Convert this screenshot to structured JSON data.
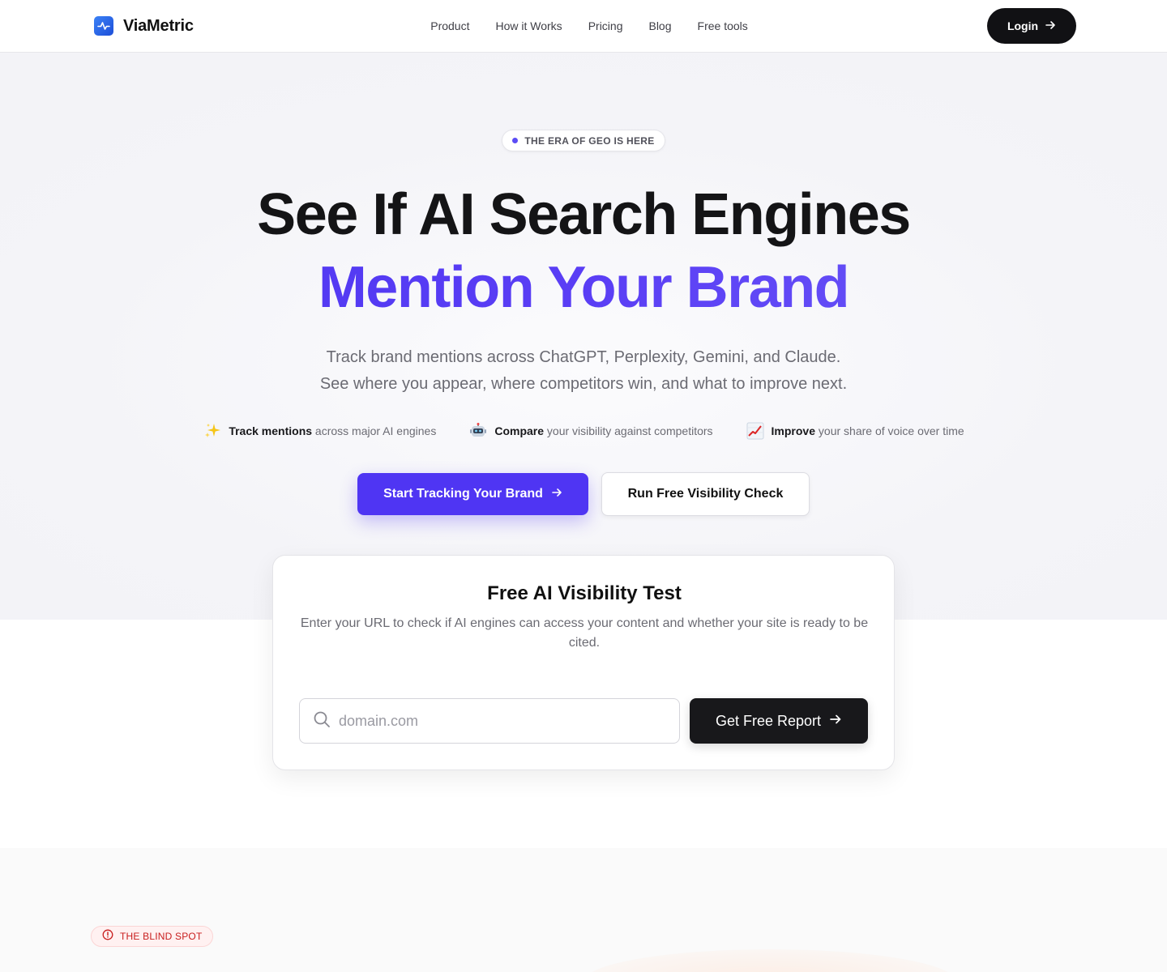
{
  "brand": {
    "name": "ViaMetric"
  },
  "nav": {
    "items": [
      "Product",
      "How it Works",
      "Pricing",
      "Blog",
      "Free tools"
    ],
    "login_label": "Login"
  },
  "hero": {
    "badge": "THE ERA OF GEO IS HERE",
    "title_line1": "See If AI Search Engines",
    "title_line2": "Mention Your Brand",
    "subtitle_line1": "Track brand mentions across ChatGPT, Perplexity, Gemini, and Claude.",
    "subtitle_line2": "See where you appear, where competitors win, and what to improve next.",
    "features": [
      {
        "icon": "sparkles-icon",
        "bold": "Track mentions",
        "rest": "across major AI engines"
      },
      {
        "icon": "robot-icon",
        "bold": "Compare",
        "rest": "your visibility against competitors"
      },
      {
        "icon": "chart-up-icon",
        "bold": "Improve",
        "rest": "your share of voice over time"
      }
    ],
    "primary_cta": "Start Tracking Your Brand",
    "secondary_cta": "Run Free Visibility Check"
  },
  "test_card": {
    "title": "Free AI Visibility Test",
    "description": "Enter your URL to check if AI engines can access your content and whether your site is ready to be cited.",
    "input_placeholder": "domain.com",
    "button_label": "Get Free Report"
  },
  "blind_spot": {
    "badge": "THE BLIND SPOT"
  },
  "colors": {
    "accent": "#4f35f3",
    "dark": "#18181b",
    "logo_blue": "#2563eb",
    "warning_red": "#c81e1e"
  }
}
